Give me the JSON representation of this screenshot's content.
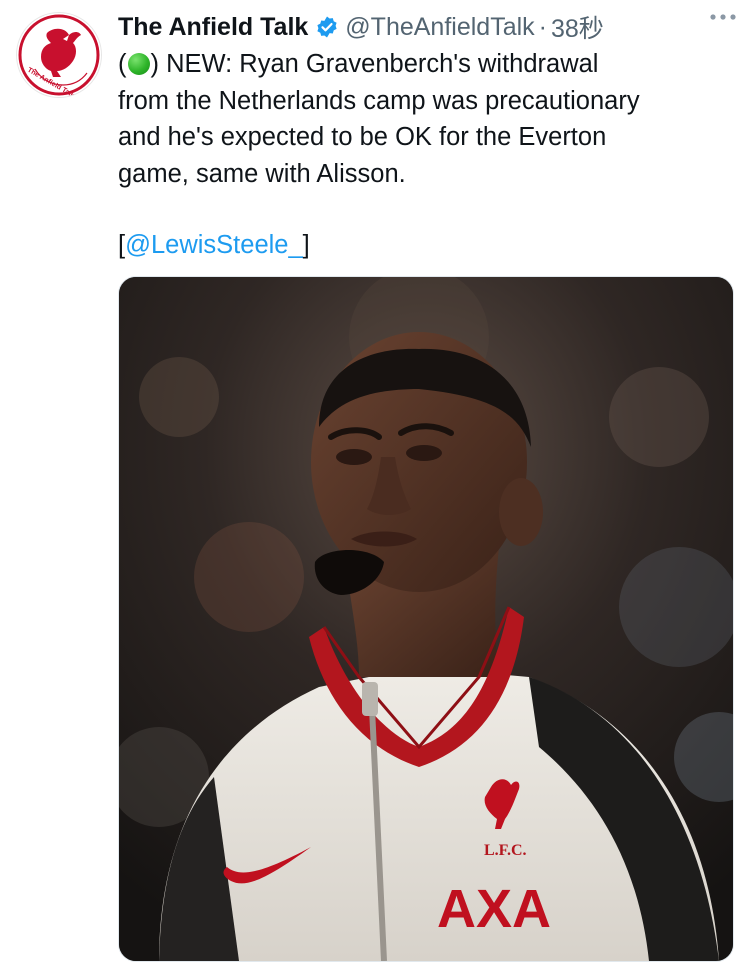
{
  "tweet": {
    "display_name": "The Anfield Talk",
    "handle": "@TheAnfieldTalk",
    "separator": "·",
    "time": "38秒",
    "text_lines": [
      ") NEW: Ryan Gravenberch's withdrawal",
      "from the Netherlands camp was precautionary",
      "and he's expected to be OK for the Everton",
      "game, same with Alisson."
    ],
    "text_prefix": "(",
    "mention_open": "[",
    "mention": "@LewisSteele_",
    "mention_close": "]"
  },
  "avatar": {
    "logo_text": "The Anfield Talk",
    "colors": {
      "brand": "#c8102e"
    }
  },
  "media": {
    "jacket_text": "L.F.C.",
    "sponsor_text": "AXA",
    "colors": {
      "jacket_red": "#b3161e",
      "jacket_white": "#e8e4de"
    }
  },
  "icons": {
    "verified": "verified-badge-icon",
    "more": "more-options-icon",
    "green_circle": "green-circle-emoji"
  },
  "colors": {
    "text": "#0f1419",
    "secondary": "#536471",
    "link": "#1d9bf0",
    "verified": "#1d9bf0"
  }
}
